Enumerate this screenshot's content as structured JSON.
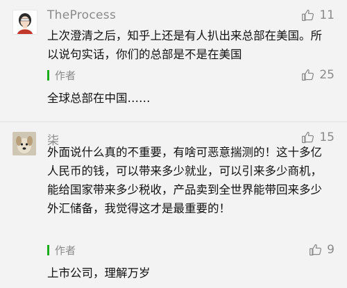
{
  "comments": [
    {
      "username": "TheProcess",
      "likes": "11",
      "text": "上次澄清之后，知乎上还是有人扒出来总部在美国。所以说句实话，你们的总部是不是在美国",
      "reply": {
        "author_label": "作者",
        "likes": "25",
        "text": "全球总部在中国……"
      }
    },
    {
      "username": "柒",
      "likes": "15",
      "text": "外面说什么真的不重要，有啥可恶意揣测的！这十多亿人民币的钱，可以带来多少就业，可以引来多少商机，能给国家带来多少税收，产品卖到全世界能带回来多少外汇储备，我觉得这才是最重要的！",
      "reply": {
        "author_label": "作者",
        "likes": "9",
        "text": "上市公司，理解万岁"
      }
    }
  ],
  "icons": {
    "like": "thumbs-up-icon"
  },
  "colors": {
    "accent": "#1aad19",
    "muted": "#8a8a8a"
  }
}
